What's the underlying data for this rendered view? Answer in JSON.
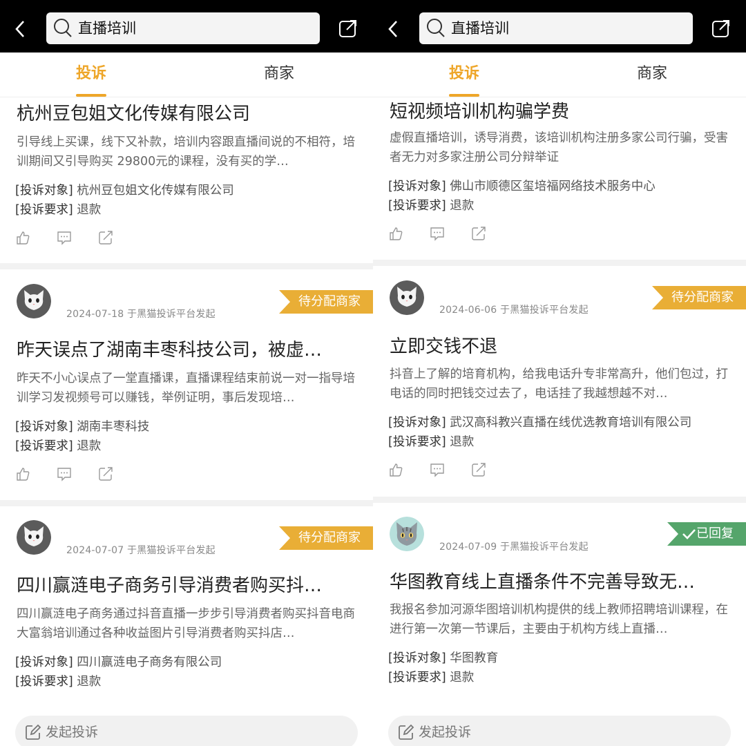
{
  "search": {
    "query": "直播培训"
  },
  "tabs": {
    "complaints": "投诉",
    "merchants": "商家"
  },
  "compose": {
    "label": "发起投诉"
  },
  "icons": {
    "back": "chevron-left-icon",
    "search": "search-icon",
    "share": "share-icon",
    "like": "thumbs-up-icon",
    "comment": "comment-icon",
    "card_share": "share-icon",
    "compose": "edit-icon"
  },
  "colors": {
    "accent": "#eea629",
    "badge_pending": "#e9ae36",
    "badge_replied": "#55a56b"
  },
  "labels": {
    "target": "[投诉对象]",
    "request": "[投诉要求]"
  },
  "left": {
    "cards": [
      {
        "title": "杭州豆包姐文化传媒有限公司",
        "desc": "引导线上买课，线下又补款，培训内容跟直播间说的不相符，培训期间又引导购买 29800元的课程，没有买的学…",
        "target": "杭州豆包姐文化传媒有限公司",
        "request": "退款"
      },
      {
        "date": "2024-07-18 于黑猫投诉平台发起",
        "badge": "待分配商家",
        "title": "昨天误点了湖南丰枣科技公司，被虚…",
        "desc": "昨天不小心误点了一堂直播课，直播课程结束前说一对一指导培训学习发视频号可以赚钱，举例证明，事后发现培…",
        "target": "湖南丰枣科技",
        "request": "退款"
      },
      {
        "date": "2024-07-07 于黑猫投诉平台发起",
        "badge": "待分配商家",
        "title": "四川赢涟电子商务引导消费者购买抖…",
        "desc": "四川赢涟电子商务通过抖音直播一步步引导消费者购买抖音电商大富翁培训通过各种收益图片引导消费者购买抖店…",
        "target": "四川赢涟电子商务有限公司",
        "request": "退款"
      }
    ]
  },
  "right": {
    "cards": [
      {
        "title": "短视频培训机构骗学费",
        "desc": "虚假直播培训，诱导消费，该培训机构注册多家公司行骗，受害者无力对多家注册公司分辩举证",
        "target": "佛山市顺德区玺培福网络技术服务中心",
        "request": "退款"
      },
      {
        "date": "2024-06-06 于黑猫投诉平台发起",
        "badge": "待分配商家",
        "title": "立即交钱不退",
        "desc": "抖音上了解的培育机构，给我电话升专非常高升，他们包过，打电话的同时把钱交过去了，电话挂了我越想越不对…",
        "target": "武汉高科教兴直播在线优选教育培训有限公司",
        "request": "退款"
      },
      {
        "date": "2024-07-09 于黑猫投诉平台发起",
        "badge": "已回复",
        "title": "华图教育线上直播条件不完善导致无…",
        "desc": "我报名参加河源华图培训机构提供的线上教师招聘培训课程，在进行第一次第一节课后，主要由于机构方线上直播…",
        "target": "华图教育",
        "request": "退款"
      }
    ]
  }
}
